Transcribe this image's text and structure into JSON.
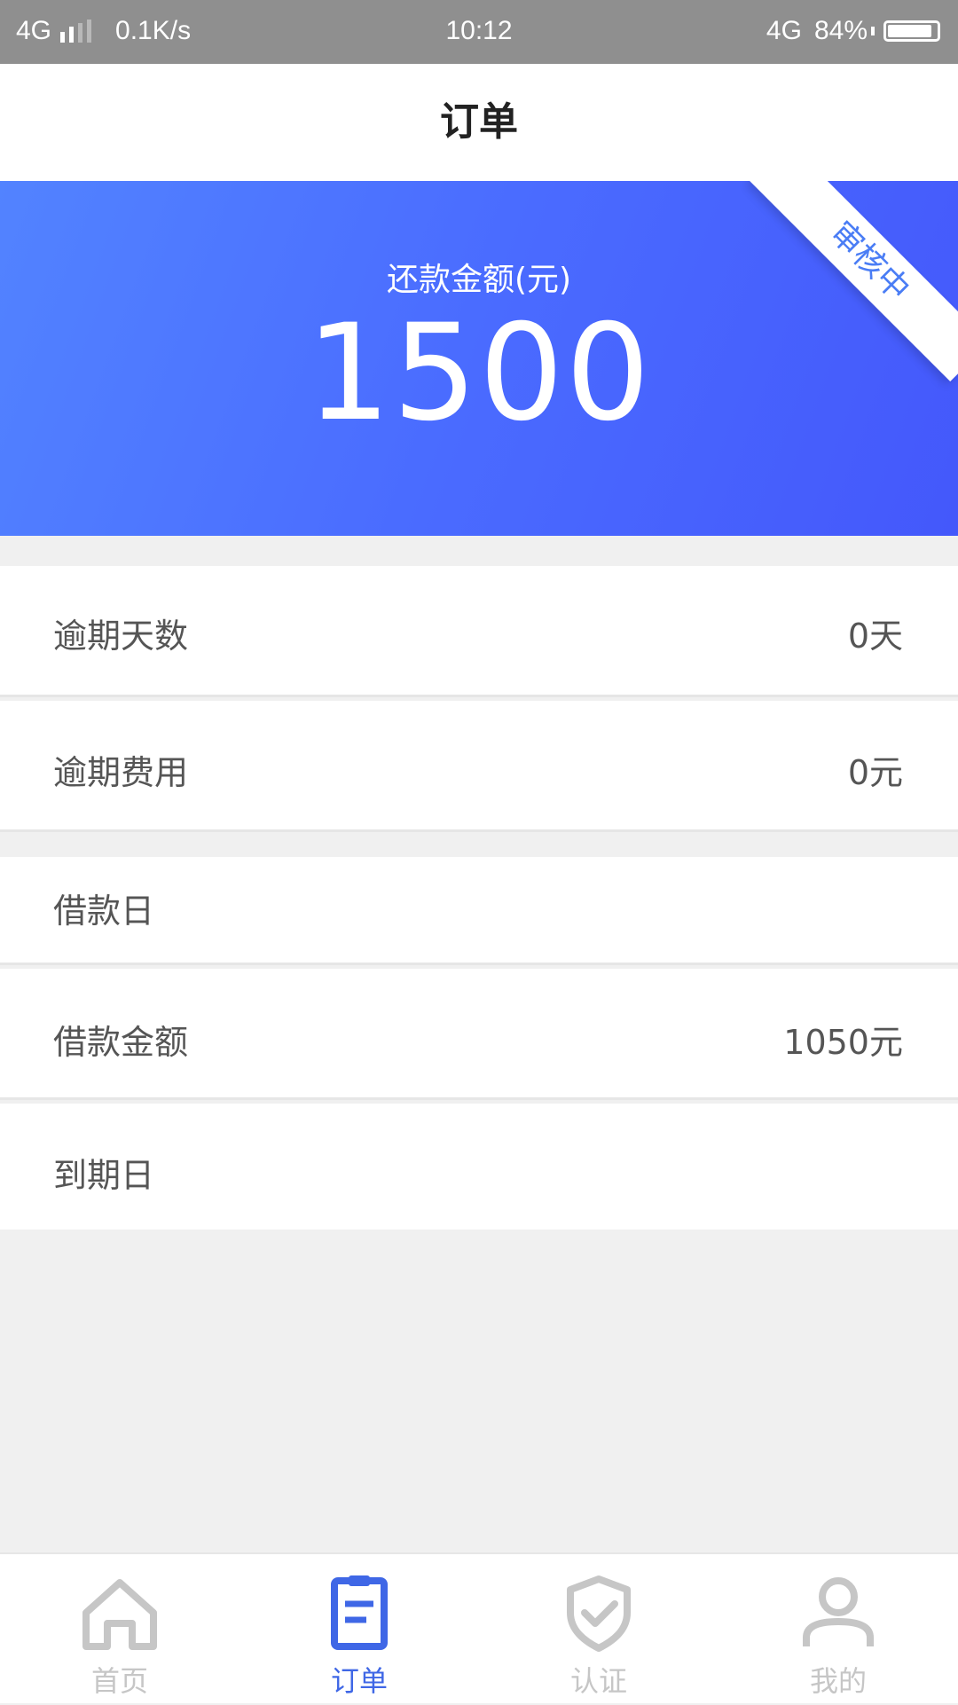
{
  "status_bar": {
    "network": "4G",
    "speed": "0.1K/s",
    "time": "10:12",
    "network_right": "4G",
    "battery": "84%"
  },
  "header": {
    "title": "订单"
  },
  "hero": {
    "label": "还款金额(元)",
    "amount": "1500",
    "ribbon": "审核中",
    "colors": {
      "start": "#5283ff",
      "end": "#4458fb"
    }
  },
  "details": [
    {
      "label": "逾期天数",
      "value": "0天"
    },
    {
      "label": "逾期费用",
      "value": "0元"
    },
    {
      "label": "借款日",
      "value": ""
    },
    {
      "label": "借款金额",
      "value": "1050元"
    },
    {
      "label": "到期日",
      "value": ""
    }
  ],
  "tab_bar": {
    "active_color": "#3f67e6",
    "inactive_color": "#c6c6c6",
    "tabs": [
      {
        "label": "首页",
        "icon": "home-icon"
      },
      {
        "label": "订单",
        "icon": "order-icon"
      },
      {
        "label": "认证",
        "icon": "shield-check-icon"
      },
      {
        "label": "我的",
        "icon": "user-icon"
      }
    ]
  }
}
